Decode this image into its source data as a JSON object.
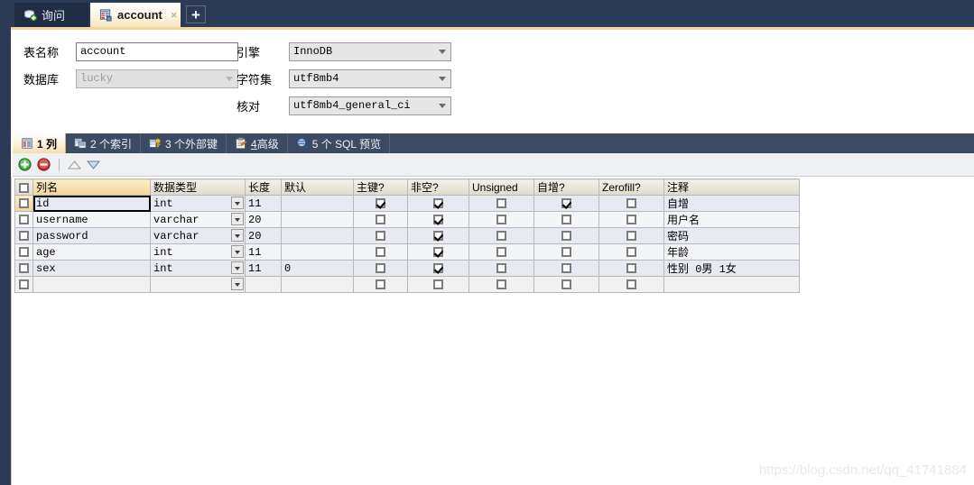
{
  "window": {
    "tabs": [
      {
        "label": "询问",
        "icon": "query-icon",
        "active": false,
        "closable": false
      },
      {
        "label": "account",
        "icon": "table-icon",
        "active": true,
        "closable": true,
        "close_glyph": "×"
      }
    ],
    "new_tab_label": "+"
  },
  "form": {
    "table_name_label": "表名称",
    "table_name_value": "account",
    "database_label": "数据库",
    "database_value": "lucky",
    "engine_label": "引擎",
    "engine_value": "InnoDB",
    "charset_label": "字符集",
    "charset_value": "utf8mb4",
    "collation_label": "核对",
    "collation_value": "utf8mb4_general_ci"
  },
  "inner_tabs": [
    {
      "label": "1 列",
      "icon": "columns-icon",
      "selected": true
    },
    {
      "label": "2 个索引",
      "icon": "index-icon",
      "selected": false
    },
    {
      "label": "3 个外部键",
      "icon": "foreign-key-icon",
      "selected": false
    },
    {
      "label": "4高级",
      "icon": "advanced-icon",
      "selected": false,
      "underline_first": true
    },
    {
      "label": "5 个 SQL 预览",
      "icon": "sql-preview-icon",
      "selected": false
    }
  ],
  "toolbar": {
    "add_label": "+",
    "remove_label": "−",
    "move_up_label": "△",
    "move_down_label": "▽"
  },
  "grid": {
    "columns": [
      {
        "key": "check",
        "label": "",
        "width": 20,
        "type": "check"
      },
      {
        "key": "name",
        "label": "列名",
        "width": 130,
        "type": "text",
        "highlight": true
      },
      {
        "key": "datatype",
        "label": "数据类型",
        "width": 105,
        "type": "select"
      },
      {
        "key": "length",
        "label": "长度",
        "width": 40,
        "type": "text"
      },
      {
        "key": "default",
        "label": "默认",
        "width": 80,
        "type": "text"
      },
      {
        "key": "pk",
        "label": "主键?",
        "width": 60,
        "type": "check"
      },
      {
        "key": "notnull",
        "label": "非空?",
        "width": 68,
        "type": "check"
      },
      {
        "key": "unsigned",
        "label": "Unsigned",
        "width": 72,
        "type": "check"
      },
      {
        "key": "autoinc",
        "label": "自增?",
        "width": 72,
        "type": "check"
      },
      {
        "key": "zerofill",
        "label": "Zerofill?",
        "width": 72,
        "type": "check"
      },
      {
        "key": "comment",
        "label": "注释",
        "width": 150,
        "type": "text"
      }
    ],
    "rows": [
      {
        "check": false,
        "name": "id",
        "datatype": "int",
        "length": "11",
        "default": "",
        "pk": true,
        "notnull": true,
        "unsigned": false,
        "autoinc": true,
        "zerofill": false,
        "comment": "自增",
        "selected": true,
        "editing": true
      },
      {
        "check": false,
        "name": "username",
        "datatype": "varchar",
        "length": "20",
        "default": "",
        "pk": false,
        "notnull": true,
        "unsigned": false,
        "autoinc": false,
        "zerofill": false,
        "comment": "用户名",
        "selected": false,
        "editing": false
      },
      {
        "check": false,
        "name": "password",
        "datatype": "varchar",
        "length": "20",
        "default": "",
        "pk": false,
        "notnull": true,
        "unsigned": false,
        "autoinc": false,
        "zerofill": false,
        "comment": "密码",
        "selected": false,
        "editing": false
      },
      {
        "check": false,
        "name": "age",
        "datatype": "int",
        "length": "11",
        "default": "",
        "pk": false,
        "notnull": true,
        "unsigned": false,
        "autoinc": false,
        "zerofill": false,
        "comment": "年龄",
        "selected": false,
        "editing": false
      },
      {
        "check": false,
        "name": "sex",
        "datatype": "int",
        "length": "11",
        "default": "0",
        "pk": false,
        "notnull": true,
        "unsigned": false,
        "autoinc": false,
        "zerofill": false,
        "comment": "性别 0男 1女",
        "selected": false,
        "editing": false
      },
      {
        "check": false,
        "name": "",
        "datatype": "",
        "length": "",
        "default": "",
        "pk": false,
        "notnull": false,
        "unsigned": false,
        "autoinc": false,
        "zerofill": false,
        "comment": "",
        "selected": false,
        "editing": false,
        "blank": true
      }
    ]
  },
  "watermark": "https://blog.csdn.net/qq_41741884",
  "colors": {
    "titlebar": "#2b3a55",
    "accent_gold": "#f0d79a",
    "inner_tabbar": "#3c4a63",
    "row_odd": "#e7eaf3",
    "row_even": "#f4f5f7",
    "grid_border": "#b8b8b8"
  }
}
